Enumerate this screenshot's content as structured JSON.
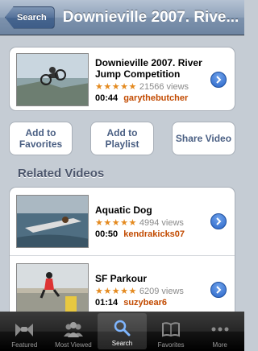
{
  "navbar": {
    "back_label": "Search",
    "title": "Downieville 2007. Rive..."
  },
  "main_video": {
    "title": "Downieville 2007. River Jump Competition",
    "stars": "★★★★★",
    "views": "21566 views",
    "duration": "00:44",
    "user": "garythebutcher"
  },
  "actions": [
    {
      "label": "Add to Favorites"
    },
    {
      "label": "Add to Playlist"
    },
    {
      "label": "Share Video"
    }
  ],
  "related": {
    "heading": "Related Videos",
    "items": [
      {
        "title": "Aquatic Dog",
        "stars": "★★★★★",
        "views": "4994 views",
        "duration": "00:50",
        "user": "kendrakicks07"
      },
      {
        "title": "SF Parkour",
        "stars": "★★★★★",
        "views": "6209 views",
        "duration": "01:14",
        "user": "suzybear6"
      }
    ]
  },
  "tabbar": {
    "items": [
      {
        "label": "Featured",
        "icon": "featured-icon"
      },
      {
        "label": "Most Viewed",
        "icon": "most-viewed-icon"
      },
      {
        "label": "Search",
        "icon": "search-icon",
        "active": true
      },
      {
        "label": "Favorites",
        "icon": "favorites-icon"
      },
      {
        "label": "More",
        "icon": "more-icon"
      }
    ]
  },
  "colors": {
    "accent_blue": "#2a66c9",
    "user_link": "#c24a00",
    "stars": "#e48a1f"
  }
}
